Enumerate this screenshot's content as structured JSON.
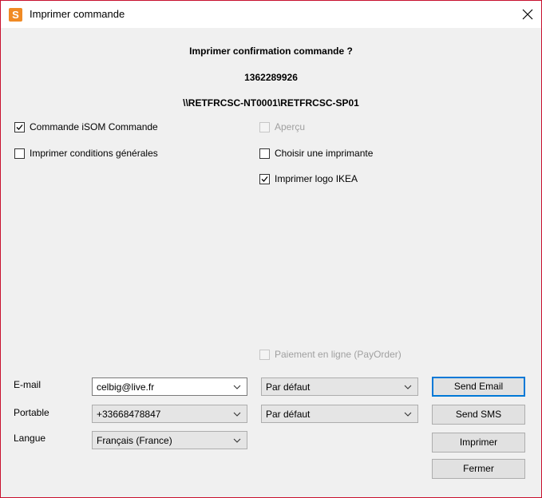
{
  "window": {
    "title": "Imprimer commande",
    "app_icon_letter": "S"
  },
  "header": {
    "question": "Imprimer confirmation commande ?",
    "order_number": "1362289926",
    "printer_path": "\\\\RETFRCSC-NT0001\\RETFRCSC-SP01"
  },
  "options": {
    "commande_isom": {
      "label": "Commande iSOM Commande",
      "checked": true
    },
    "apercu": {
      "label": "Aperçu",
      "checked": false,
      "disabled": true
    },
    "conditions_generales": {
      "label": "Imprimer conditions générales",
      "checked": false
    },
    "choisir_imprimante": {
      "label": "Choisir une imprimante",
      "checked": false
    },
    "logo_ikea": {
      "label": "Imprimer logo IKEA",
      "checked": true
    },
    "paiement_en_ligne": {
      "label": "Paiement en ligne (PayOrder)",
      "checked": false,
      "disabled": true
    }
  },
  "fields": {
    "email": {
      "label": "E-mail",
      "value": "celbig@live.fr",
      "format": "Par défaut"
    },
    "portable": {
      "label": "Portable",
      "value": "+33668478847",
      "format": "Par défaut"
    },
    "langue": {
      "label": "Langue",
      "value": "Français (France)"
    }
  },
  "buttons": {
    "send_email": "Send Email",
    "send_sms": "Send SMS",
    "imprimer": "Imprimer",
    "fermer": "Fermer"
  },
  "colors": {
    "window_border": "#c8102e",
    "accent": "#0078d7",
    "app_icon": "#f08a24"
  }
}
